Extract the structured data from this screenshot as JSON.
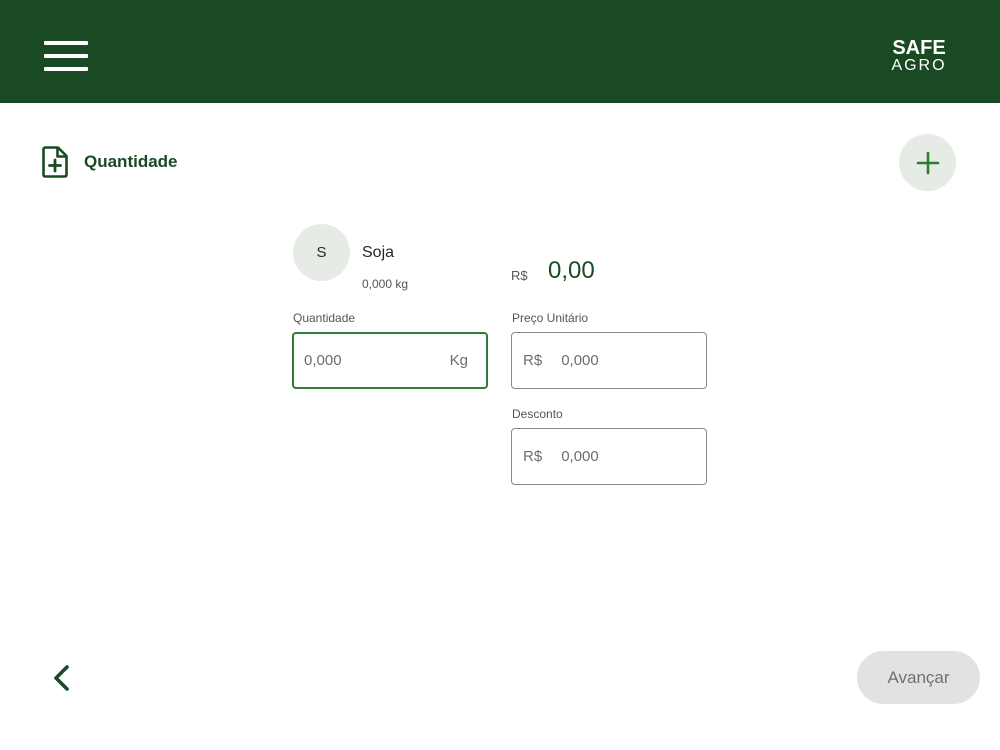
{
  "header": {
    "logo_line1": "SAFE",
    "logo_line2": "AGRO"
  },
  "page": {
    "title": "Quantidade"
  },
  "product": {
    "initial": "S",
    "name": "Soja",
    "weight": "0,000 kg"
  },
  "total": {
    "currency": "R$",
    "value": "0,00"
  },
  "fields": {
    "quantity": {
      "label": "Quantidade",
      "value": "0,000",
      "suffix": "Kg"
    },
    "unit_price": {
      "label": "Preço Unitário",
      "prefix": "R$",
      "value": "0,000"
    },
    "discount": {
      "label": "Desconto",
      "prefix": "R$",
      "value": "0,000"
    }
  },
  "footer": {
    "next_label": "Avançar"
  },
  "colors": {
    "brand_dark_green": "#1a4a24",
    "accent_green": "#2e7d32",
    "soft_circle": "#e6ebe5"
  },
  "icons": {
    "menu": "hamburger-icon",
    "document": "document-plus-icon",
    "add": "plus-icon",
    "back": "chevron-left-icon"
  }
}
